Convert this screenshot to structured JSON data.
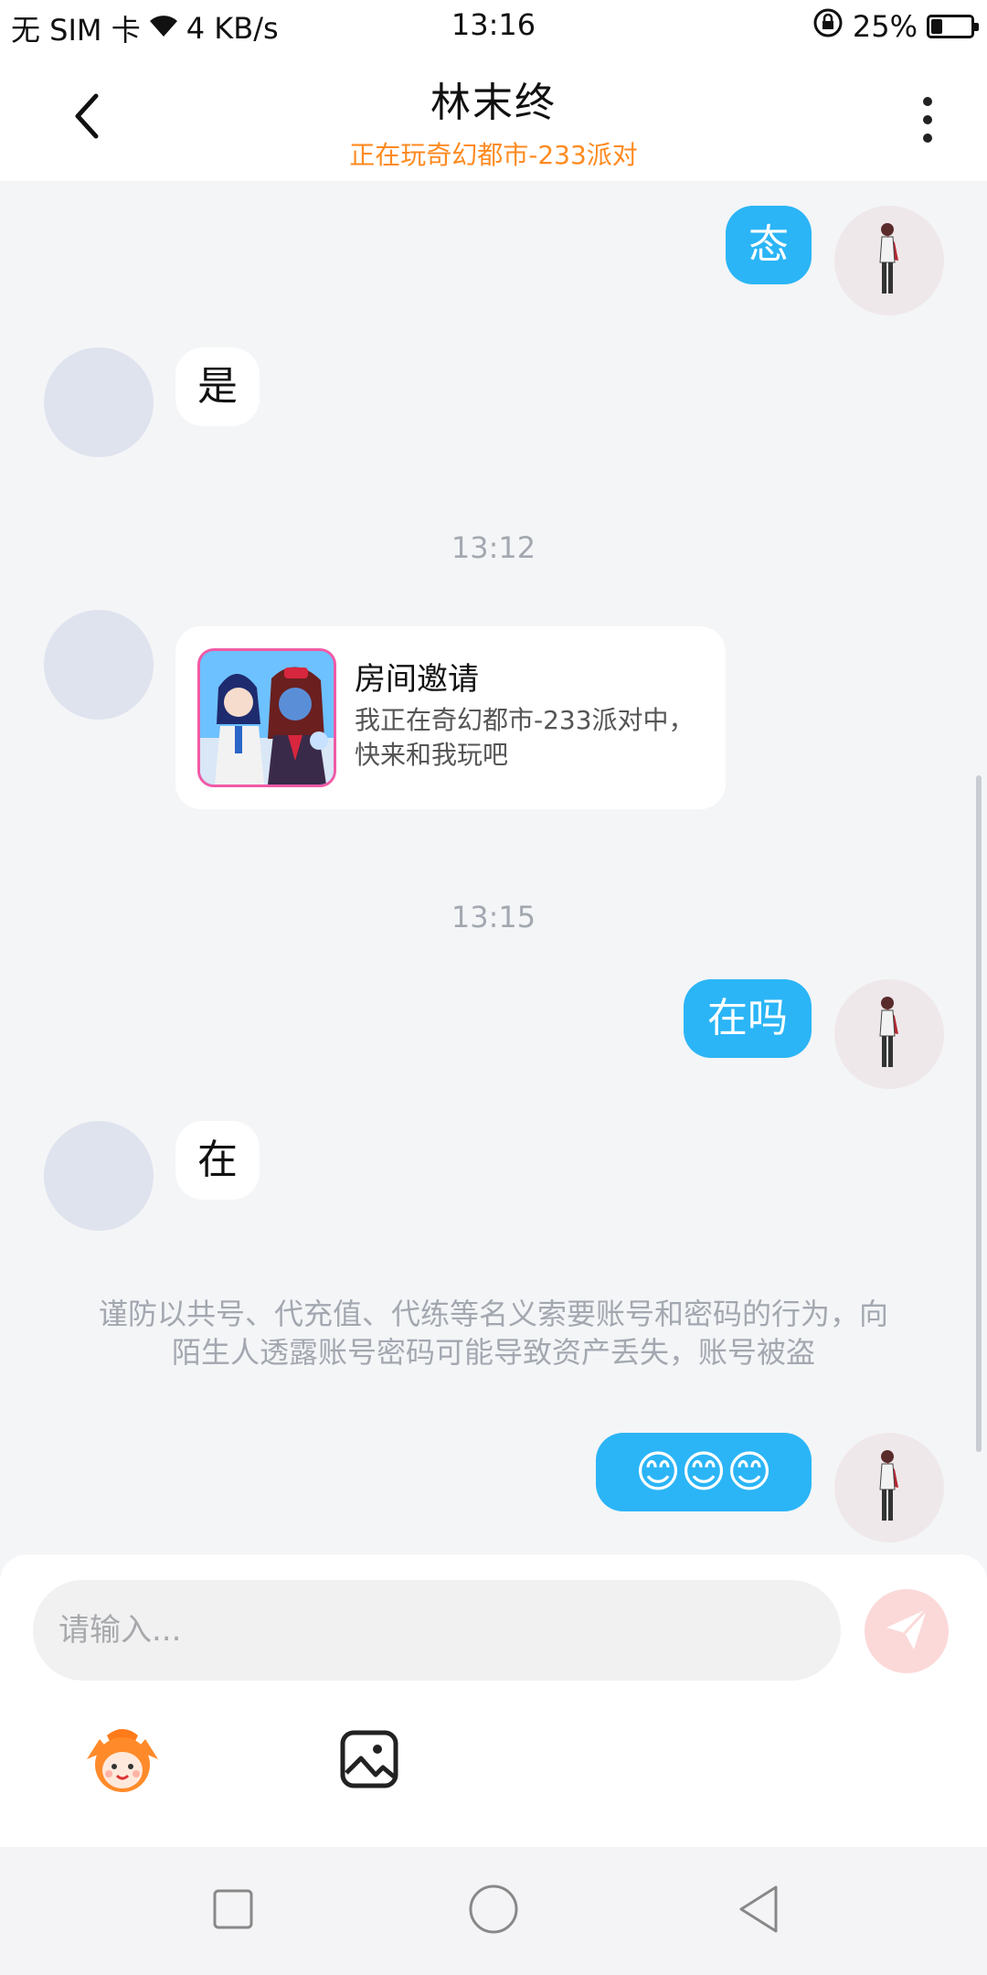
{
  "status_bar": {
    "carrier": "无 SIM 卡",
    "speed": "4 KB/s",
    "time": "13:16",
    "battery": "25%",
    "battery_level": 0.25,
    "icons": [
      "wifi-icon",
      "rotation-lock-icon",
      "battery-icon"
    ]
  },
  "header": {
    "title": "林末终",
    "subtitle": "正在玩奇幻都市-233派对",
    "back_icon": "chevron-left-icon",
    "more_icon": "more-vertical-icon"
  },
  "messages": [
    {
      "sender": "me",
      "text": "态"
    },
    {
      "sender": "other",
      "text": "是"
    },
    {
      "type": "timestamp",
      "text": "13:12"
    },
    {
      "sender": "other",
      "type": "room-invite",
      "title": "房间邀请",
      "description": "我正在奇幻都市-233派对中，快来和我玩吧"
    },
    {
      "type": "timestamp",
      "text": "13:15"
    },
    {
      "sender": "me",
      "text": "在吗"
    },
    {
      "sender": "other",
      "text": "在"
    },
    {
      "type": "notice",
      "text": "谨防以共号、代充值、代练等名义索要账号和密码的行为，向陌生人透露账号密码可能导致资产丢失，账号被盗"
    },
    {
      "sender": "me",
      "text": "😊😊😊"
    }
  ],
  "composer": {
    "placeholder": "请输入...",
    "value": "",
    "send_icon": "send-icon",
    "tools": [
      "emoji-mascot-icon",
      "image-icon"
    ]
  },
  "colors": {
    "accent_blue": "#2bb5f6",
    "subtitle_orange": "#ff8a1f",
    "background": "#f4f5f7"
  },
  "nav": [
    "recents-icon",
    "home-icon",
    "back-icon"
  ]
}
